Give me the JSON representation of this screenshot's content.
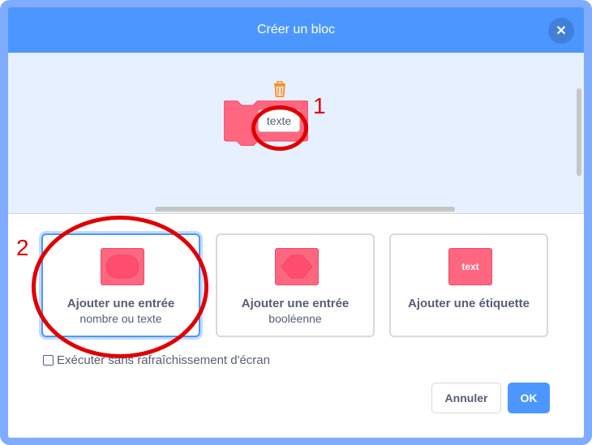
{
  "dialog": {
    "title": "Créer un bloc",
    "close_icon": "close-icon"
  },
  "preview": {
    "input_text": "texte",
    "block_color": "#ff6680",
    "trash_icon": "trash-icon"
  },
  "annotations": {
    "marker_1": "1",
    "marker_2": "2",
    "color": "#e00000"
  },
  "options": [
    {
      "title": "Ajouter une entrée",
      "subtitle": "nombre ou texte",
      "icon": "round-input-icon",
      "selected": true
    },
    {
      "title": "Ajouter une entrée",
      "subtitle": "booléenne",
      "icon": "boolean-input-icon",
      "selected": false
    },
    {
      "title": "Ajouter une étiquette",
      "subtitle": "",
      "icon": "label-icon",
      "icon_text": "text",
      "selected": false
    }
  ],
  "checkbox": {
    "label": "Exécuter sans rafraîchissement d'écran",
    "checked": false
  },
  "buttons": {
    "cancel": "Annuler",
    "ok": "OK"
  },
  "colors": {
    "header": "#4c97ff",
    "accent": "#4c97ff",
    "block": "#ff6680",
    "preview_bg": "#e6f0ff"
  }
}
